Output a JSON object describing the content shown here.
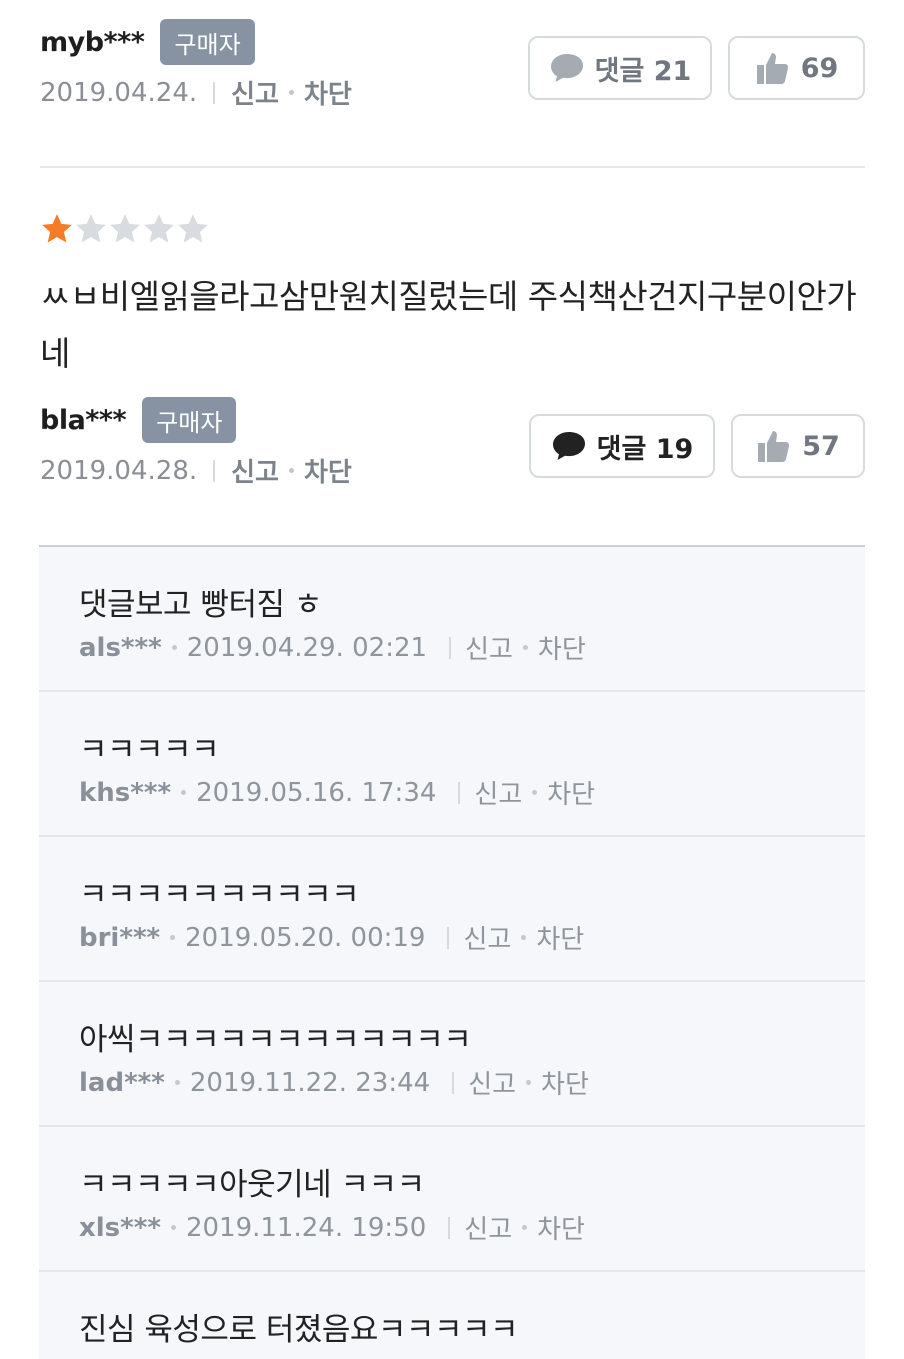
{
  "review1": {
    "username": "myb***",
    "badge": "구매자",
    "date": "2019.04.24.",
    "report": "신고",
    "block": "차단",
    "comment_label": "댓글 21",
    "like_count": "69"
  },
  "review2": {
    "rating": 1,
    "max_rating": 5,
    "star_on_color": "#f57c27",
    "star_off_color": "#d8dbdf",
    "text": "ㅆㅂ비엘읽을라고삼만원치질렀는데 주식책산건지구분이안가네",
    "username": "bla***",
    "badge": "구매자",
    "date": "2019.04.28.",
    "report": "신고",
    "block": "차단",
    "comment_label": "댓글 19",
    "like_count": "57"
  },
  "comments": [
    {
      "text": "댓글보고 빵터짐 ㅎ",
      "user": "als***",
      "datetime": "2019.04.29. 02:21",
      "report": "신고",
      "block": "차단"
    },
    {
      "text": "ㅋㅋㅋㅋㅋ",
      "user": "khs***",
      "datetime": "2019.05.16. 17:34",
      "report": "신고",
      "block": "차단"
    },
    {
      "text": "ㅋㅋㅋㅋㅋㅋㅋㅋㅋㅋ",
      "user": "bri***",
      "datetime": "2019.05.20. 00:19",
      "report": "신고",
      "block": "차단"
    },
    {
      "text": "아씩ㅋㅋㅋㅋㅋㅋㅋㅋㅋㅋㅋㅋ",
      "user": "lad***",
      "datetime": "2019.11.22. 23:44",
      "report": "신고",
      "block": "차단"
    },
    {
      "text": "ㅋㅋㅋㅋㅋ아웃기네 ㅋㅋㅋ",
      "user": "xls***",
      "datetime": "2019.11.24. 19:50",
      "report": "신고",
      "block": "차단"
    },
    {
      "text": "진심 육성으로 터졌음요ㅋㅋㅋㅋㅋ",
      "user": "",
      "datetime": "",
      "report": "",
      "block": ""
    }
  ]
}
